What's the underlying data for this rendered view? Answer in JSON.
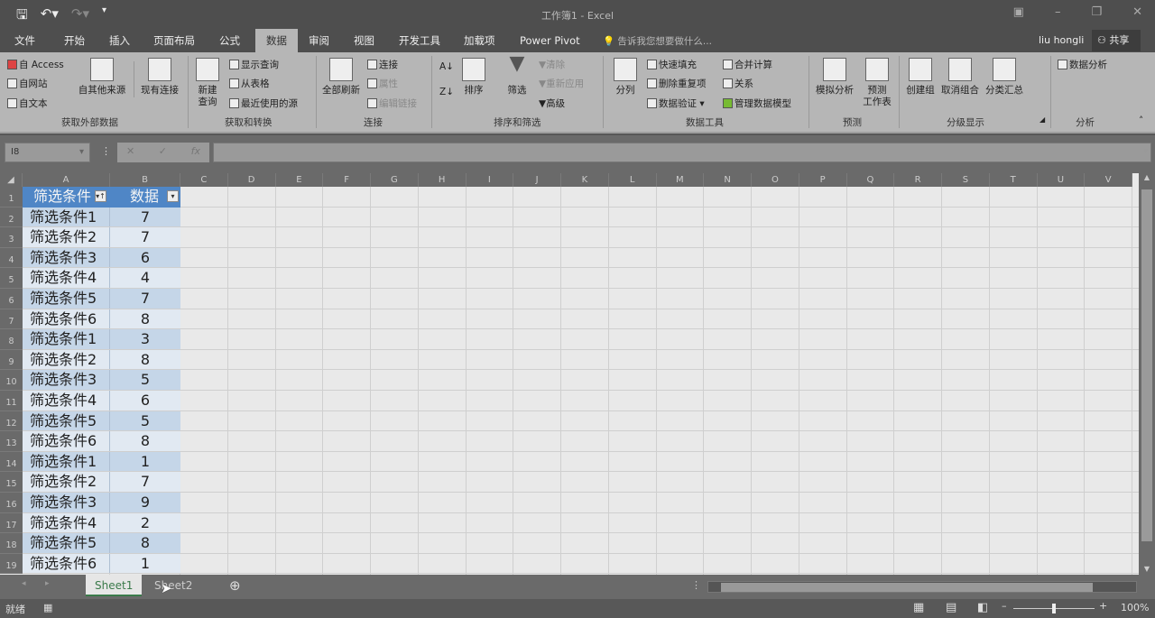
{
  "window": {
    "title": "工作簿1 - Excel",
    "user": "liu hongli",
    "share": "共享",
    "tell_me": "告诉我您想要做什么..."
  },
  "quick_access": [
    "save-icon",
    "undo-icon",
    "redo-icon",
    "customize-icon"
  ],
  "tabs": [
    {
      "label": "文件"
    },
    {
      "label": "开始"
    },
    {
      "label": "插入"
    },
    {
      "label": "页面布局"
    },
    {
      "label": "公式"
    },
    {
      "label": "数据",
      "active": true
    },
    {
      "label": "审阅"
    },
    {
      "label": "视图"
    },
    {
      "label": "开发工具"
    },
    {
      "label": "加载项"
    },
    {
      "label": "Power Pivot"
    }
  ],
  "ribbon": {
    "get_external": {
      "label": "获取外部数据",
      "access": "自 Access",
      "web": "自网站",
      "text": "自文本",
      "other": "自其他来源",
      "existing": "现有连接"
    },
    "get_transform": {
      "label": "获取和转换",
      "new_query": "新建\n查询",
      "show_query": "显示查询",
      "from_table": "从表格",
      "recent": "最近使用的源"
    },
    "connections": {
      "label": "连接",
      "refresh_all": "全部刷新",
      "connections": "连接",
      "properties": "属性",
      "edit_links": "编辑链接"
    },
    "sort_filter": {
      "label": "排序和筛选",
      "sort": "排序",
      "filter": "筛选",
      "clear": "清除",
      "reapply": "重新应用",
      "advanced": "高级"
    },
    "data_tools": {
      "label": "数据工具",
      "text_to_columns": "分列",
      "flash_fill": "快速填充",
      "remove_dup": "删除重复项",
      "validation": "数据验证",
      "consolidate": "合并计算",
      "relationships": "关系",
      "data_model": "管理数据模型"
    },
    "forecast": {
      "label": "预测",
      "what_if": "模拟分析",
      "forecast_sheet": "预测\n工作表"
    },
    "outline": {
      "label": "分级显示",
      "group": "创建组",
      "ungroup": "取消组合",
      "subtotal": "分类汇总"
    },
    "analysis": {
      "label": "分析",
      "data_analysis": "数据分析"
    }
  },
  "formula_bar": {
    "name_box": "I8",
    "fx": "fx",
    "value": ""
  },
  "columns": [
    "A",
    "B",
    "C",
    "D",
    "E",
    "F",
    "G",
    "H",
    "I",
    "J",
    "K",
    "L",
    "M",
    "N",
    "O",
    "P",
    "Q",
    "R",
    "S",
    "T",
    "U",
    "V"
  ],
  "table": {
    "headers": [
      "筛选条件",
      "数据"
    ],
    "rows": [
      [
        "筛选条件1",
        7
      ],
      [
        "筛选条件2",
        7
      ],
      [
        "筛选条件3",
        6
      ],
      [
        "筛选条件4",
        4
      ],
      [
        "筛选条件5",
        7
      ],
      [
        "筛选条件6",
        8
      ],
      [
        "筛选条件1",
        3
      ],
      [
        "筛选条件2",
        8
      ],
      [
        "筛选条件3",
        5
      ],
      [
        "筛选条件4",
        6
      ],
      [
        "筛选条件5",
        5
      ],
      [
        "筛选条件6",
        8
      ],
      [
        "筛选条件1",
        1
      ],
      [
        "筛选条件2",
        7
      ],
      [
        "筛选条件3",
        9
      ],
      [
        "筛选条件4",
        2
      ],
      [
        "筛选条件5",
        8
      ],
      [
        "筛选条件6",
        1
      ]
    ],
    "header_color": "#4f86c6"
  },
  "sheets": [
    {
      "label": "Sheet1",
      "active": true
    },
    {
      "label": "Sheet2"
    }
  ],
  "status": {
    "ready": "就绪",
    "zoom": "100%"
  }
}
